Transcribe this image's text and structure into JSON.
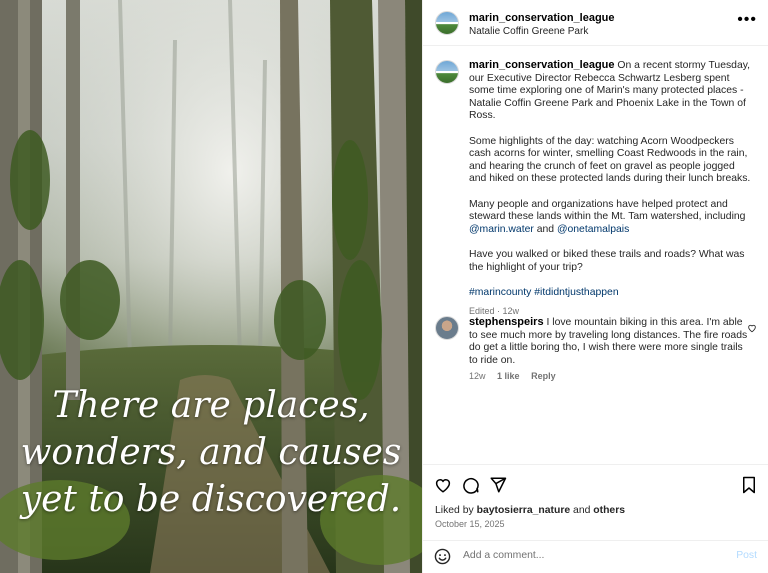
{
  "post": {
    "username": "marin_conservation_league",
    "location": "Natalie Coffin Greene Park",
    "overlay_lines": [
      "There are places,",
      "wonders, and causes",
      "yet to be discovered."
    ]
  },
  "caption": {
    "username": "marin_conservation_league",
    "p1": " On a recent stormy Tuesday, our Executive Director Rebecca Schwartz Lesberg spent some time exploring one of Marin's many protected places - Natalie Coffin Greene Park and Phoenix Lake in the Town of Ross.",
    "p2": "Some highlights of the day: watching Acorn Woodpeckers cash acorns for winter, smelling Coast Redwoods in the rain, and hearing the crunch of feet on gravel as people jogged and hiked on these protected lands during their lunch breaks.",
    "p3_start": "Many people and organizations have helped protect and steward these lands within the Mt. Tam watershed, including ",
    "mention1": "@marin.water",
    "p3_and": " and ",
    "mention2": "@onetamalpais",
    "p4": "Have you walked or biked these trails and roads? What was the highlight of your trip?",
    "hashtags": "#marincounty #itdidntjusthappen",
    "edited": "Edited",
    "edited_time": "12w"
  },
  "comment": {
    "username": "stephenspeirs",
    "text": " I love mountain biking in this area. I'm able to see much more by traveling long distances. The fire roads do get a little boring tho, I wish there were more single trails to ride on.",
    "time": "12w",
    "likes": "1 like",
    "reply": "Reply"
  },
  "footer": {
    "liked_by_prefix": "Liked by ",
    "liked_by_user": "baytosierra_nature",
    "liked_and": " and ",
    "liked_others": "others",
    "date": "October 15, 2025",
    "comment_placeholder": "Add a comment...",
    "post_label": "Post"
  },
  "icons": {
    "more": "more-icon",
    "like": "heart-icon",
    "comment": "comment-icon",
    "share": "share-icon",
    "save": "bookmark-icon",
    "emoji": "emoji-icon"
  },
  "colors": {
    "link": "#00376b",
    "secondary": "#737373",
    "post_button": "#b3dbff"
  }
}
